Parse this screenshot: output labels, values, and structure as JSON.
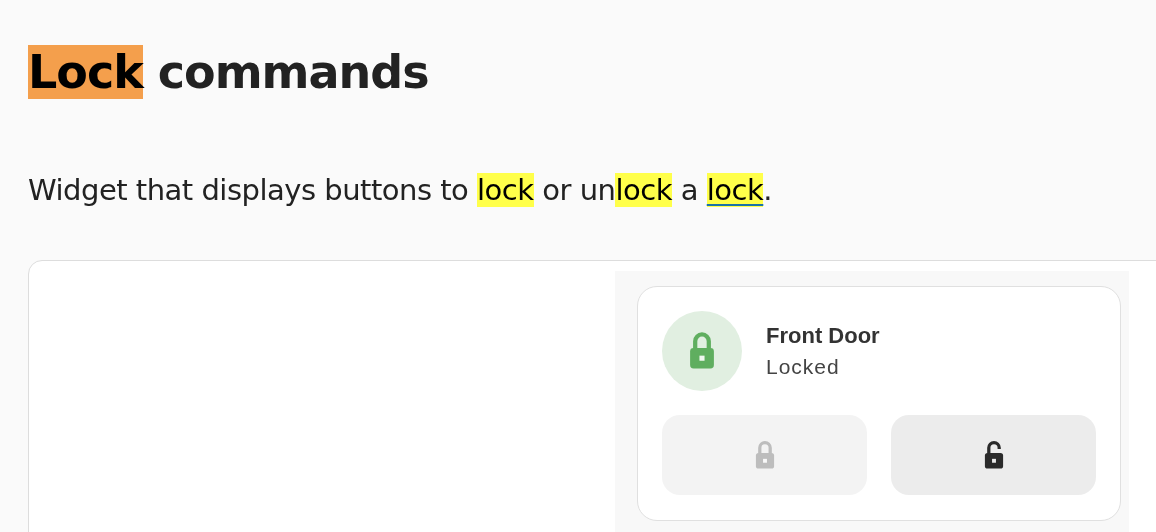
{
  "heading": [
    {
      "text": "Lock",
      "kind": "highlight"
    },
    {
      "text": " commands",
      "kind": "plain"
    }
  ],
  "description": [
    {
      "text": "Widget that displays buttons to ",
      "kind": "plain"
    },
    {
      "text": "lock",
      "kind": "highlight"
    },
    {
      "text": " or un",
      "kind": "plain"
    },
    {
      "text": "lock",
      "kind": "highlight"
    },
    {
      "text": " a ",
      "kind": "plain"
    },
    {
      "text": "lock",
      "kind": "link"
    },
    {
      "text": ".",
      "kind": "plain"
    }
  ],
  "preview": {
    "entity": {
      "name": "Front Door",
      "state": "Locked",
      "locked": true
    },
    "buttons": [
      {
        "kind": "lock",
        "disabled": true
      },
      {
        "kind": "unlock",
        "disabled": false
      }
    ]
  }
}
